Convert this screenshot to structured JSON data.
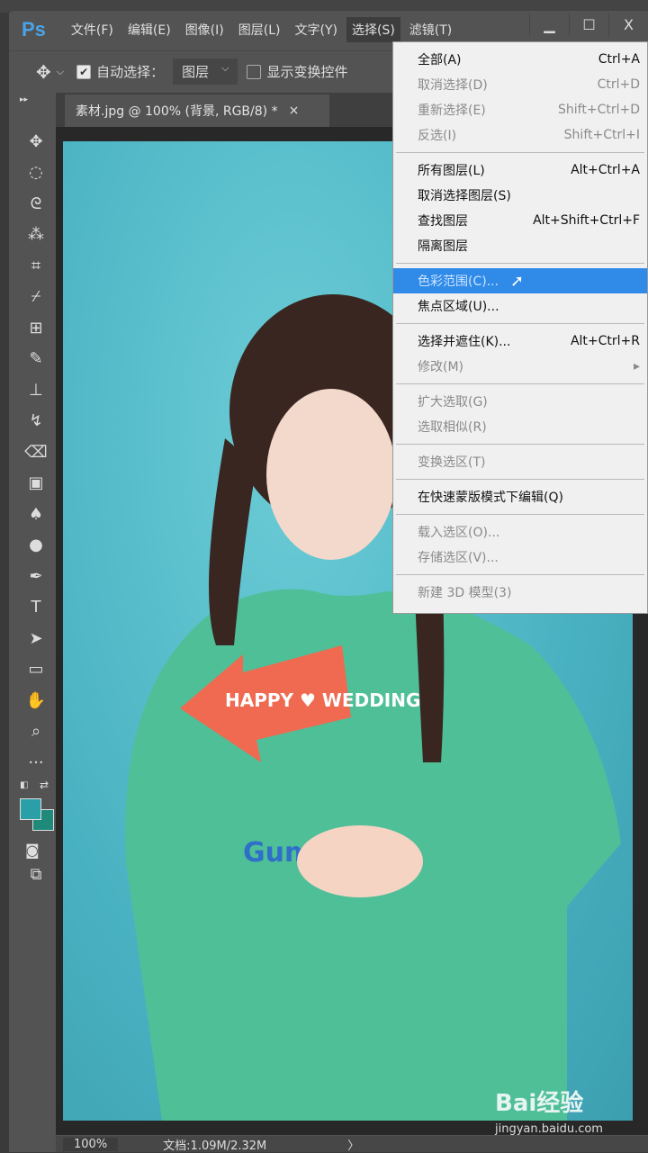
{
  "app": {
    "logo": "Ps"
  },
  "menubar": [
    "文件(F)",
    "编辑(E)",
    "图像(I)",
    "图层(L)",
    "文字(Y)",
    "选择(S)",
    "滤镜(T)"
  ],
  "window_controls": {
    "minimize": "▁",
    "maximize": "☐",
    "close": "X"
  },
  "options": {
    "auto_select_label": "自动选择：",
    "auto_select_checked": true,
    "target_value": "图层",
    "show_transform_label": "显示变换控件",
    "show_transform_checked": false
  },
  "document_tab": {
    "title": "素材.jpg @ 100% (背景, RGB/8) *",
    "close": "×"
  },
  "tools": [
    "move",
    "marquee",
    "lasso",
    "magic-wand",
    "crop",
    "eyedropper",
    "healing",
    "brush",
    "stamp",
    "history-brush",
    "eraser",
    "gradient",
    "blur",
    "dodge",
    "pen",
    "type",
    "path-select",
    "rectangle",
    "hand",
    "zoom",
    "more"
  ],
  "colors": {
    "foreground": "#2a9fa8",
    "background": "#1f8a7a",
    "highlight": "#2f8ae8"
  },
  "select_menu": {
    "groups": [
      [
        {
          "label": "全部(A)",
          "shortcut": "Ctrl+A",
          "enabled": true
        },
        {
          "label": "取消选择(D)",
          "shortcut": "Ctrl+D",
          "enabled": false
        },
        {
          "label": "重新选择(E)",
          "shortcut": "Shift+Ctrl+D",
          "enabled": false
        },
        {
          "label": "反选(I)",
          "shortcut": "Shift+Ctrl+I",
          "enabled": false
        }
      ],
      [
        {
          "label": "所有图层(L)",
          "shortcut": "Alt+Ctrl+A",
          "enabled": true
        },
        {
          "label": "取消选择图层(S)",
          "shortcut": "",
          "enabled": true
        },
        {
          "label": "查找图层",
          "shortcut": "Alt+Shift+Ctrl+F",
          "enabled": true
        },
        {
          "label": "隔离图层",
          "shortcut": "",
          "enabled": true
        }
      ],
      [
        {
          "label": "色彩范围(C)...",
          "shortcut": "",
          "enabled": true,
          "highlighted": true
        },
        {
          "label": "焦点区域(U)...",
          "shortcut": "",
          "enabled": true
        }
      ],
      [
        {
          "label": "选择并遮住(K)...",
          "shortcut": "Alt+Ctrl+R",
          "enabled": true
        },
        {
          "label": "修改(M)",
          "shortcut": "▸",
          "enabled": false
        }
      ],
      [
        {
          "label": "扩大选取(G)",
          "shortcut": "",
          "enabled": false
        },
        {
          "label": "选取相似(R)",
          "shortcut": "",
          "enabled": false
        }
      ],
      [
        {
          "label": "变换选区(T)",
          "shortcut": "",
          "enabled": false
        }
      ],
      [
        {
          "label": "在快速蒙版模式下编辑(Q)",
          "shortcut": "",
          "enabled": true
        }
      ],
      [
        {
          "label": "载入选区(O)...",
          "shortcut": "",
          "enabled": false
        },
        {
          "label": "存储选区(V)...",
          "shortcut": "",
          "enabled": false
        }
      ],
      [
        {
          "label": "新建 3D 模型(3)",
          "shortcut": "",
          "enabled": false
        }
      ]
    ]
  },
  "canvas": {
    "sign_text": "HAPPY ♥ WEDDING",
    "shirt_text": "Gumby"
  },
  "watermark": {
    "brand": "Bai经验",
    "url": "jingyan.baidu.com"
  },
  "status": {
    "zoom": "100%",
    "doc_info": "文档:1.09M/2.32M",
    "arrow": "〉"
  }
}
